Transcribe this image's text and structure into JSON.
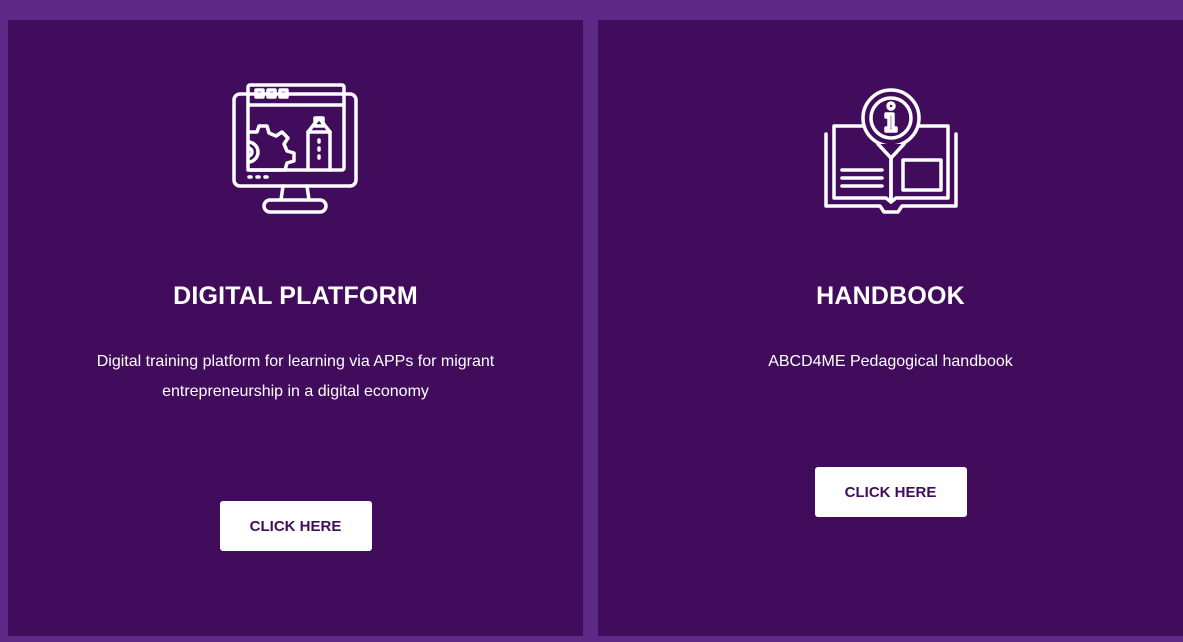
{
  "cards": [
    {
      "icon": "computer-monitor-icon",
      "title": "DIGITAL PLATFORM",
      "description": "Digital training platform for learning via APPs for migrant entrepreneurship in a digital economy",
      "button_label": "CLICK HERE"
    },
    {
      "icon": "info-book-icon",
      "title": "HANDBOOK",
      "description": "ABCD4ME Pedagogical handbook",
      "button_label": "CLICK HERE"
    }
  ],
  "colors": {
    "page_background": "#5c2a86",
    "card_background": "#420c5c",
    "text": "#ffffff",
    "button_background": "#ffffff",
    "button_text": "#420c5c"
  }
}
